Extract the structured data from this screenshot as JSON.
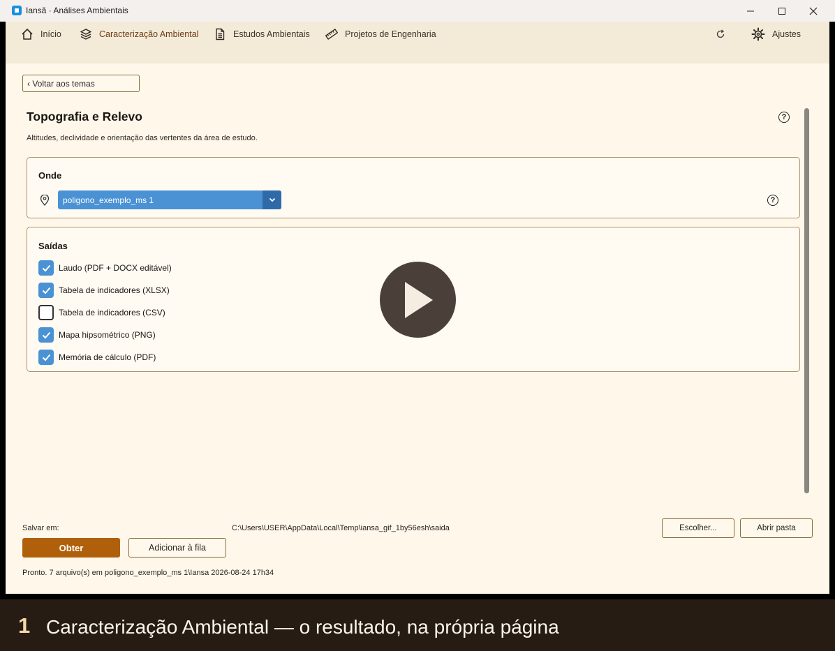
{
  "window": {
    "title": "Iansã · Análises Ambientais"
  },
  "nav": {
    "items": [
      {
        "label": "Início",
        "icon": "home-icon"
      },
      {
        "label": "Caracterização Ambiental",
        "icon": "layers-icon"
      },
      {
        "label": "Estudos Ambientais",
        "icon": "document-icon"
      },
      {
        "label": "Projetos de Engenharia",
        "icon": "ruler-icon"
      }
    ],
    "settings_label": "Ajustes"
  },
  "back_label": "‹ Voltar aos temas",
  "page": {
    "title": "Topografia e Relevo",
    "subtitle": "Altitudes, declividade e orientação das vertentes da área de estudo."
  },
  "onde": {
    "title": "Onde",
    "selected_area": "poligono_exemplo_ms 1"
  },
  "saidas": {
    "title": "Saídas",
    "items": [
      {
        "label": "Laudo (PDF + DOCX editável)",
        "checked": true
      },
      {
        "label": "Tabela de indicadores (XLSX)",
        "checked": true
      },
      {
        "label": "Tabela de indicadores (CSV)",
        "checked": false
      },
      {
        "label": "Mapa hipsométrico (PNG)",
        "checked": true
      },
      {
        "label": "Memória de cálculo (PDF)",
        "checked": true
      }
    ]
  },
  "save": {
    "label": "Salvar em:",
    "path": "C:\\Users\\USER\\AppData\\Local\\Temp\\iansa_gif_1by56esh\\saida",
    "choose_label": "Escolher...",
    "open_folder_label": "Abrir pasta"
  },
  "actions": {
    "obter_label": "Obter",
    "queue_label": "Adicionar à fila"
  },
  "status": "Pronto. 7 arquivo(s) em poligono_exemplo_ms 1\\Iansa 2026-08-24 17h34",
  "caption": {
    "number": "1",
    "text": "Caracterização Ambiental — o resultado, na própria página"
  },
  "colors": {
    "accent": "#b0600a",
    "select": "#4a92d4",
    "nav_bg": "#f4ead8",
    "page_bg": "#fef7ea",
    "caption_bg": "#261c14"
  }
}
